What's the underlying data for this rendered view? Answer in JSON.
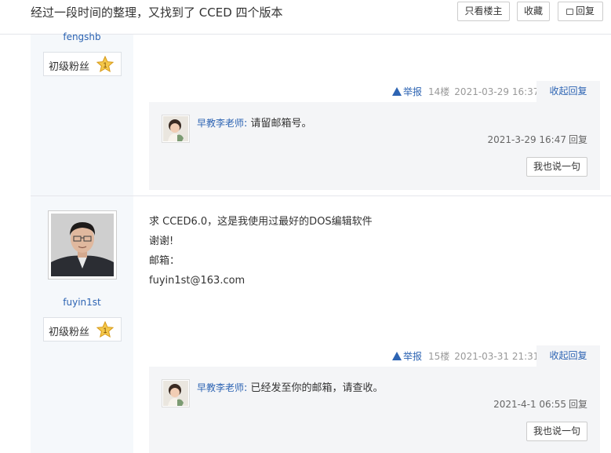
{
  "thread": {
    "title": "经过一段时间的整理，又找到了 CCED 四个版本",
    "buttons": {
      "only_host": "只看楼主",
      "collect": "收藏",
      "reply": "回复"
    }
  },
  "posts": [
    {
      "author": "fengshb",
      "level": "初级粉丝",
      "level_num": "1",
      "content": [],
      "tail": {
        "report": "举报",
        "floor": "14楼",
        "time": "2021-03-29 16:37",
        "fold": "收起回复"
      },
      "replies": [
        {
          "author": "早教李老师",
          "separator": ":",
          "text": "请留邮箱号。",
          "time": "2021-3-29 16:47",
          "reply_label": "回复"
        }
      ],
      "say_button": "我也说一句"
    },
    {
      "author": "fuyin1st",
      "level": "初级粉丝",
      "level_num": "1",
      "content": [
        "求 CCED6.0，这是我使用过最好的DOS编辑软件",
        "谢谢!",
        "邮箱：",
        "fuyin1st@163.com"
      ],
      "tail": {
        "report": "举报",
        "floor": "15楼",
        "time": "2021-03-31 21:31",
        "fold": "收起回复"
      },
      "replies": [
        {
          "author": "早教李老师",
          "separator": ":",
          "text": "已经发至你的邮箱，请查收。",
          "time": "2021-4-1 06:55",
          "reply_label": "回复"
        }
      ],
      "say_button": "我也说一句"
    }
  ],
  "colors": {
    "link_blue": "#2d64b3",
    "sidebar_bg": "#f5f8fb",
    "reply_bg": "#f4f5f7",
    "badge_star": "#f4c84a"
  },
  "icons": [
    "report-warning-icon",
    "reply-icon",
    "level-star-icon"
  ]
}
